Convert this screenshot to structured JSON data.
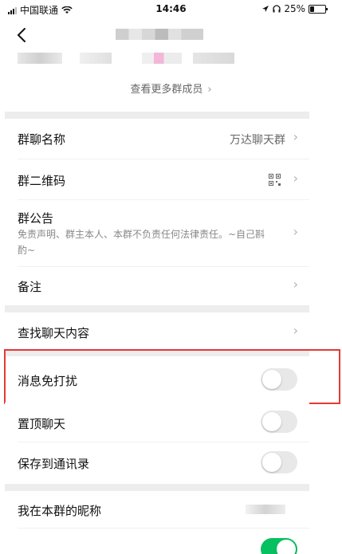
{
  "status_bar": {
    "carrier": "中国联通",
    "time": "14:46",
    "battery": "25%"
  },
  "members": {
    "more_label": "查看更多群成员"
  },
  "settings": {
    "group_name": {
      "label": "群聊名称",
      "value": "万达聊天群"
    },
    "qr_code": {
      "label": "群二维码"
    },
    "notice": {
      "label": "群公告",
      "text": "免责声明、群主本人、本群不负责任何法律责任。~自己斟酌~"
    },
    "remark": {
      "label": "备注"
    },
    "search_history": {
      "label": "查找聊天内容"
    },
    "mute": {
      "label": "消息免打扰",
      "on": false
    },
    "pin": {
      "label": "置顶聊天",
      "on": false
    },
    "save_to_contacts": {
      "label": "保存到通讯录",
      "on": false
    },
    "my_nickname": {
      "label": "我在本群的昵称"
    }
  },
  "colors": {
    "toggle_on": "#07c160",
    "highlight": "#e53935"
  }
}
